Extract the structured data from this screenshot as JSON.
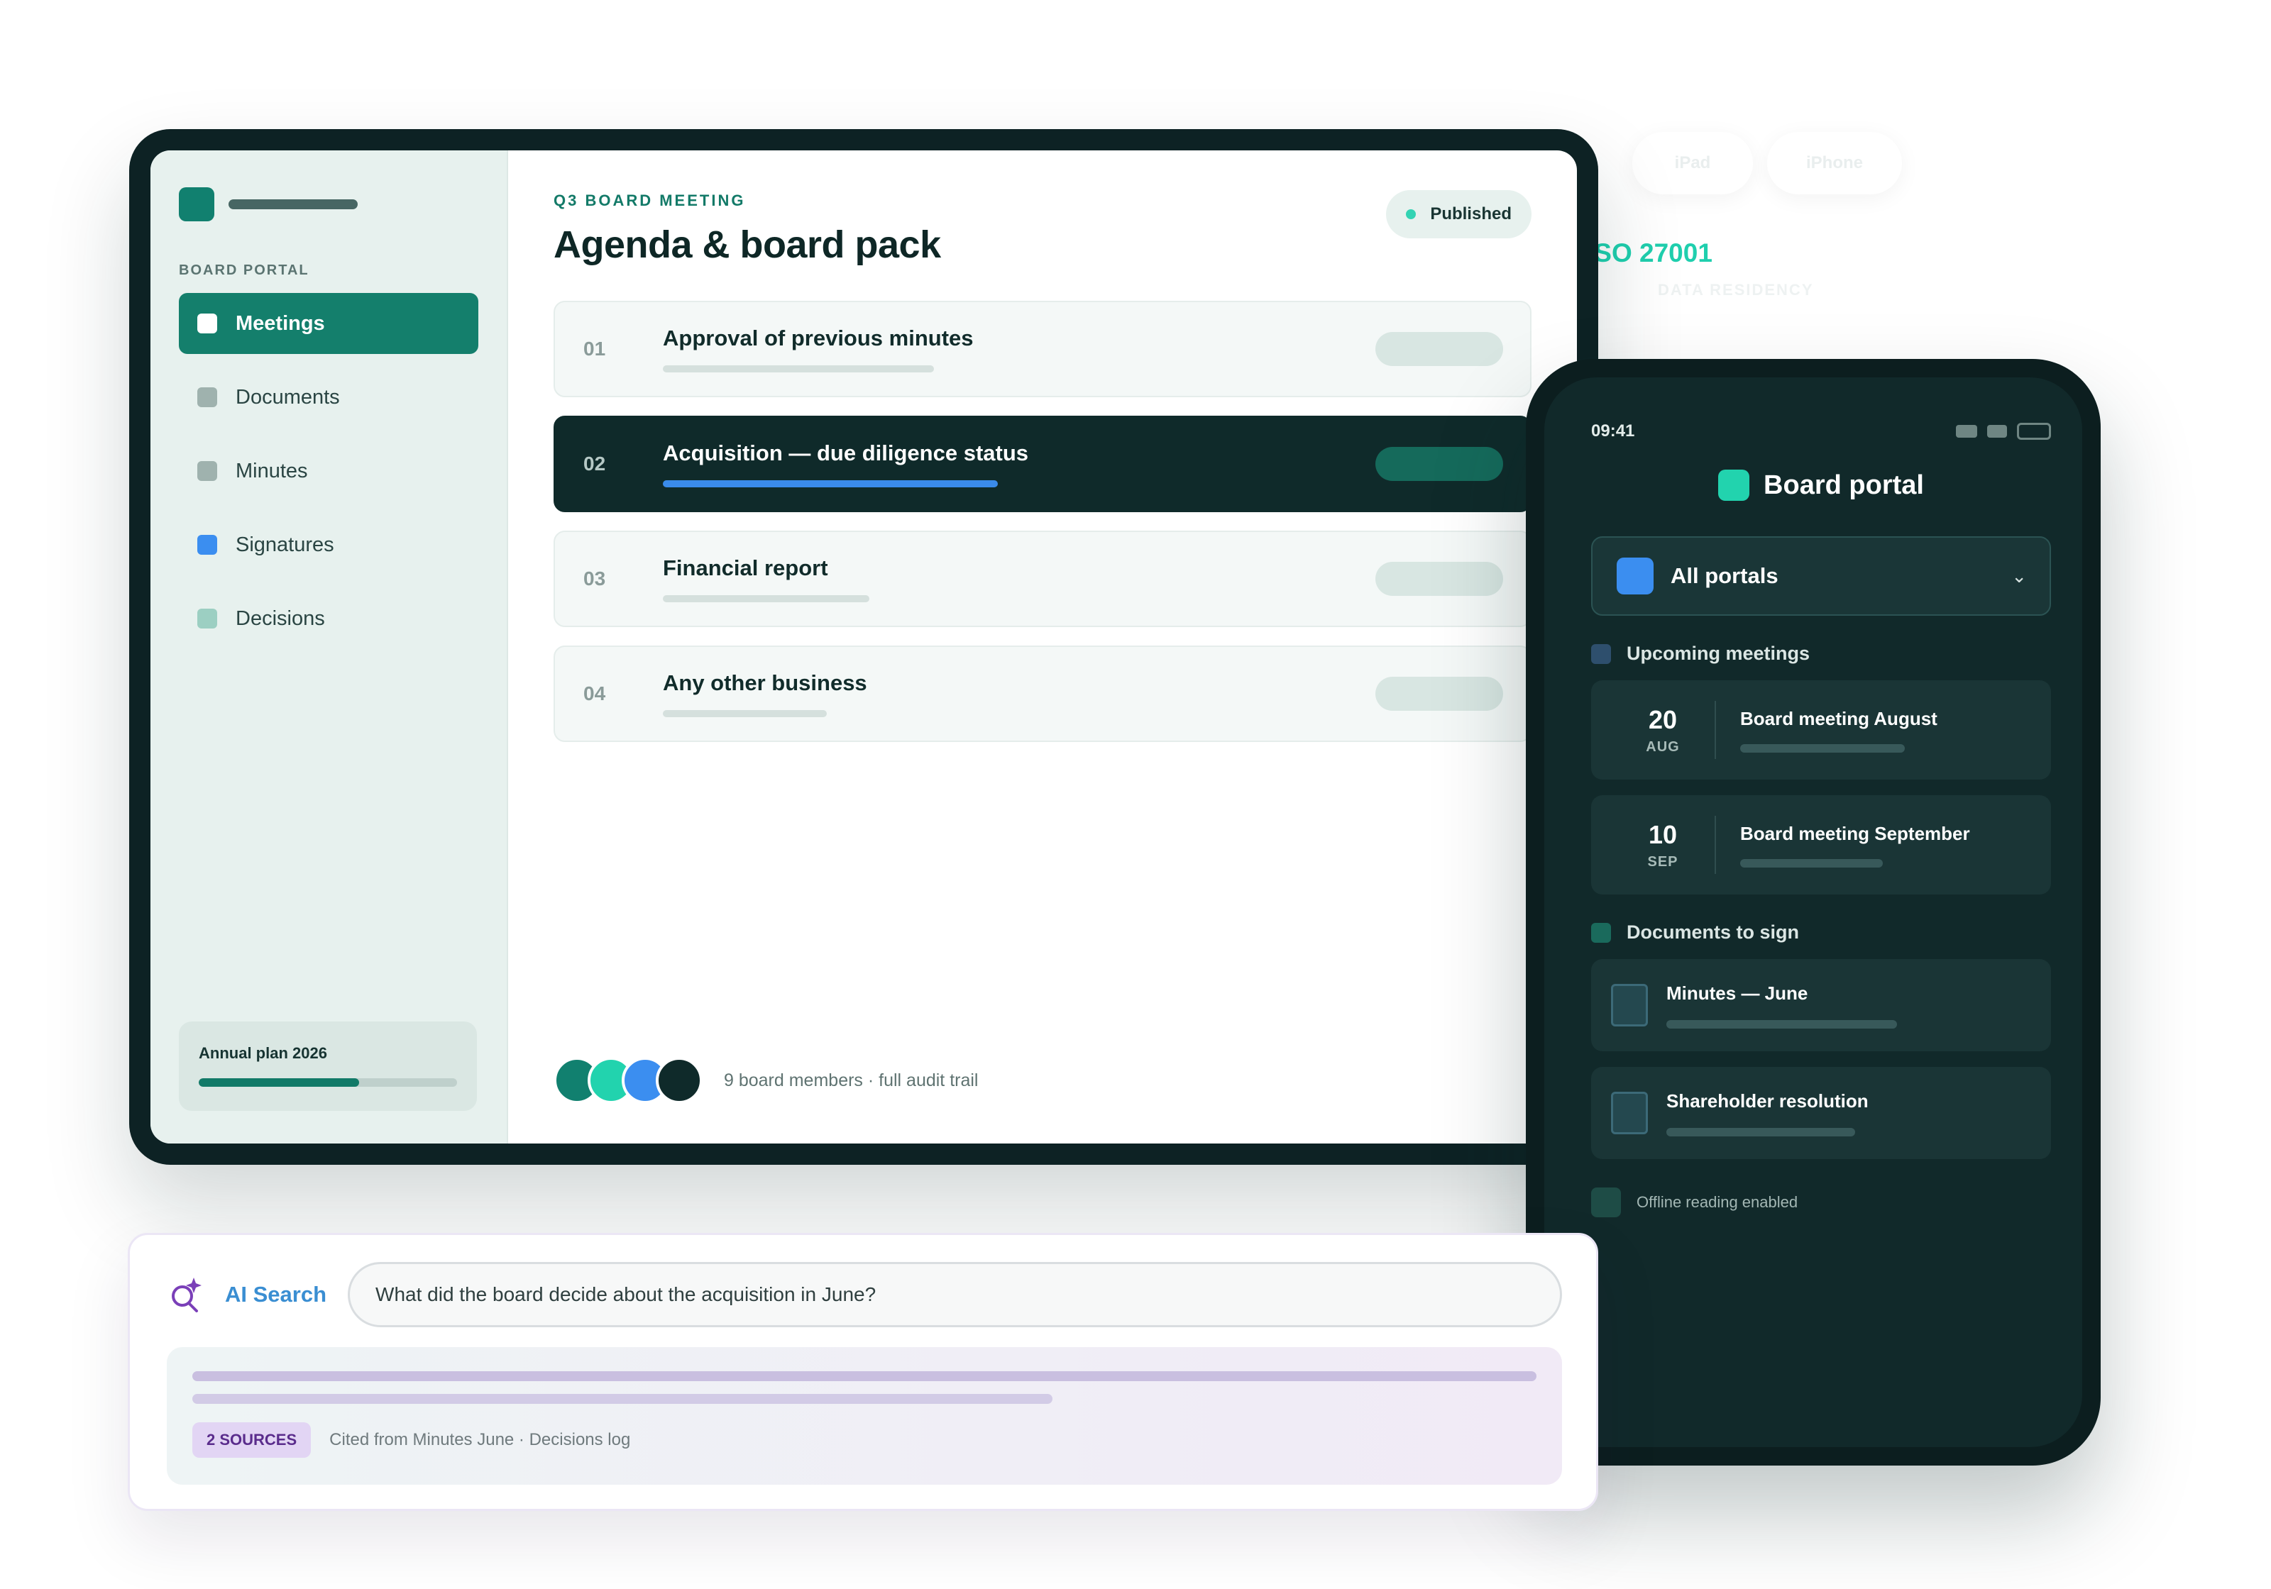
{
  "colors": {
    "brand": "#147f6c",
    "dark": "#0f2a2a",
    "accent_blue": "#3b8ef0",
    "mint": "#22d3ae",
    "ai_purple": "#5a2c8c"
  },
  "background": {
    "chips": [
      "iPad",
      "iPhone"
    ],
    "iso_title": "ISO 27001",
    "iso_subtitle": "DATA RESIDENCY"
  },
  "tablet": {
    "sidebar": {
      "caption": "BOARD PORTAL",
      "items": [
        {
          "label": "Meetings",
          "icon": "meetings-icon",
          "color": "#ffffff",
          "active": true
        },
        {
          "label": "Documents",
          "icon": "documents-icon",
          "color": "#9fb2ae",
          "active": false
        },
        {
          "label": "Minutes",
          "icon": "minutes-icon",
          "color": "#9fb2ae",
          "active": false
        },
        {
          "label": "Signatures",
          "icon": "signatures-icon",
          "color": "#3b8ef0",
          "active": false
        },
        {
          "label": "Decisions",
          "icon": "decisions-icon",
          "color": "#9ccfc2",
          "active": false
        }
      ],
      "plan": {
        "label": "Annual plan 2026",
        "progress": 0.62
      }
    },
    "main": {
      "eyebrow": "Q3 BOARD MEETING",
      "title": "Agenda & board pack",
      "status": "Published",
      "agenda": [
        {
          "num": "01",
          "title": "Approval of previous minutes",
          "bar": 0.38,
          "active": false
        },
        {
          "num": "02",
          "title": "Acquisition — due diligence status",
          "bar": 0.47,
          "active": true
        },
        {
          "num": "03",
          "title": "Financial report",
          "bar": 0.29,
          "active": false
        },
        {
          "num": "04",
          "title": "Any other business",
          "bar": 0.23,
          "active": false
        }
      ],
      "avatars": [
        "#11806f",
        "#22d3ae",
        "#3b8ef0",
        "#0f2a2a"
      ],
      "members_text": "9 board members · full audit trail"
    }
  },
  "phone": {
    "time": "09:41",
    "brand": "Board portal",
    "select_label": "All portals",
    "upcoming_title": "Upcoming meetings",
    "meetings": [
      {
        "day": "20",
        "month": "AUG",
        "title": "Board meeting August",
        "bar": 0.53
      },
      {
        "day": "10",
        "month": "SEP",
        "title": "Board meeting September",
        "bar": 0.46
      }
    ],
    "docs_title": "Documents to sign",
    "documents": [
      {
        "title": "Minutes — June",
        "bar": 0.6
      },
      {
        "title": "Shareholder resolution",
        "bar": 0.49
      }
    ],
    "offline_text": "Offline reading enabled"
  },
  "ai_search": {
    "label": "AI Search",
    "query": "What did the board decide about the acquisition in June?",
    "badge": "2 SOURCES",
    "citation": "Cited from Minutes June · Decisions log"
  }
}
